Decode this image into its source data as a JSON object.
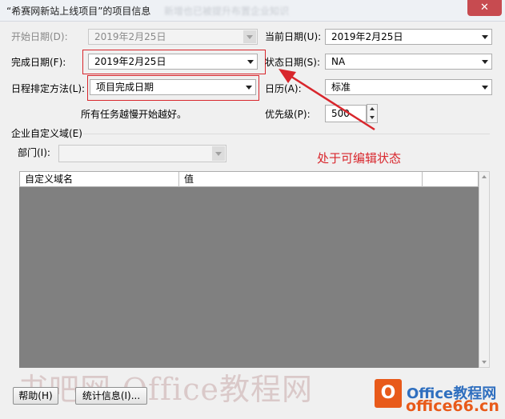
{
  "window": {
    "title": "“希赛网新站上线项目”的项目信息",
    "title_suffix_blurred": "新增也已被提升布置企业知识",
    "close": "✕"
  },
  "fields": {
    "start_date": {
      "label": "开始日期(D):",
      "value": "2019年2月25日"
    },
    "current_date": {
      "label": "当前日期(U):",
      "value": "2019年2月25日"
    },
    "finish_date": {
      "label": "完成日期(F):",
      "value": "2019年2月25日"
    },
    "status_date": {
      "label": "状态日期(S):",
      "value": "NA"
    },
    "schedule_from": {
      "label": "日程排定方法(L):",
      "value": "项目完成日期"
    },
    "calendar": {
      "label": "日历(A):",
      "value": "标准"
    },
    "note": "所有任务越慢开始越好。",
    "priority": {
      "label": "优先级(P):",
      "value": "500"
    }
  },
  "enterprise": {
    "section_label": "企业自定义域(E)",
    "department_label": "部门(I):",
    "department_value": "",
    "columns": [
      "自定义域名",
      "值",
      ""
    ]
  },
  "buttons": {
    "help": "帮助(H)",
    "statistics": "统计信息(I)..."
  },
  "annotation": "处于可编辑状态",
  "watermark": "书吧网-Office教程网",
  "logo": {
    "line1": "Office教程网",
    "line2": "office66.cn"
  }
}
